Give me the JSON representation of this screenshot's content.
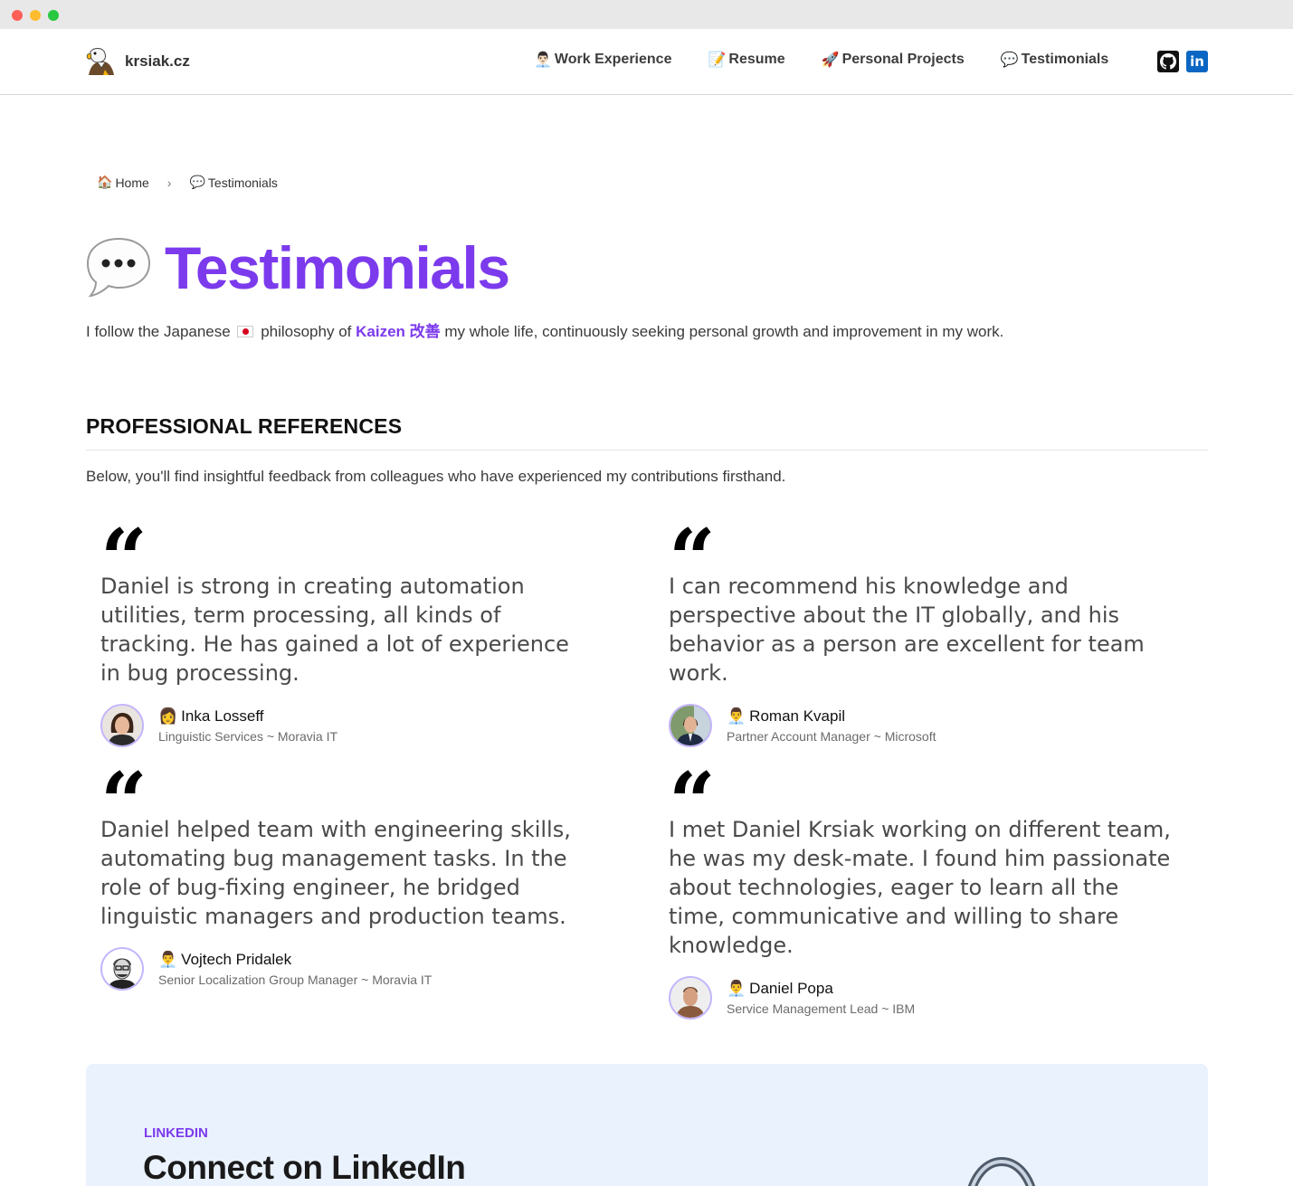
{
  "site": {
    "name": "krsiak.cz"
  },
  "nav": [
    {
      "emoji": "👨🏻‍💼",
      "label": "Work Experience"
    },
    {
      "emoji": "📝",
      "label": "Resume"
    },
    {
      "emoji": "🚀",
      "label": "Personal Projects"
    },
    {
      "emoji": "💬",
      "label": "Testimonials"
    }
  ],
  "social": {
    "github_icon": "github-icon",
    "linkedin_label": "in"
  },
  "breadcrumb": [
    {
      "emoji": "🏠",
      "label": "Home"
    },
    {
      "emoji": "💬",
      "label": "Testimonials"
    }
  ],
  "page": {
    "title": "Testimonials",
    "intro_before": "I follow the Japanese",
    "intro_mid": "philosophy of",
    "intro_kaizen": "Kaizen 改善",
    "intro_after": "my whole life, continuously seeking personal growth and improvement in my work."
  },
  "references": {
    "heading": "PROFESSIONAL REFERENCES",
    "description": "Below, you'll find insightful feedback from colleagues who have experienced my contributions firsthand.",
    "items": [
      {
        "quote": "Daniel is strong in creating automation utilities, term processing, all kinds of tracking. He has gained a lot of experience in bug processing.",
        "emoji": "👩",
        "name": "Inka Losseff",
        "role": "Linguistic Services ~ Moravia IT"
      },
      {
        "quote": "I can recommend his knowledge and perspective about the IT globally, and his behavior as a person are excellent for team work.",
        "emoji": "👨‍💼",
        "name": "Roman Kvapil",
        "role": "Partner Account Manager ~ Microsoft"
      },
      {
        "quote": "Daniel helped team with engineering skills, automating bug management tasks. In the role of bug-fixing engineer, he bridged linguistic managers and production teams.",
        "emoji": "👨‍💼",
        "name": "Vojtech Pridalek",
        "role": "Senior Localization Group Manager ~ Moravia IT"
      },
      {
        "quote": "I met Daniel Krsiak working on different team, he was my desk-mate. I found him passionate about technologies, eager to learn all the time, communicative and willing to share knowledge.",
        "emoji": "👨‍💼",
        "name": "Daniel Popa",
        "role": "Service Management Lead ~ IBM"
      }
    ]
  },
  "linkedin": {
    "eyebrow": "LINKEDIN",
    "title": "Connect on LinkedIn"
  },
  "colors": {
    "accent": "#7c3aed",
    "linkedin": "#0a66c2",
    "cta_background": "#eaf2fd"
  }
}
